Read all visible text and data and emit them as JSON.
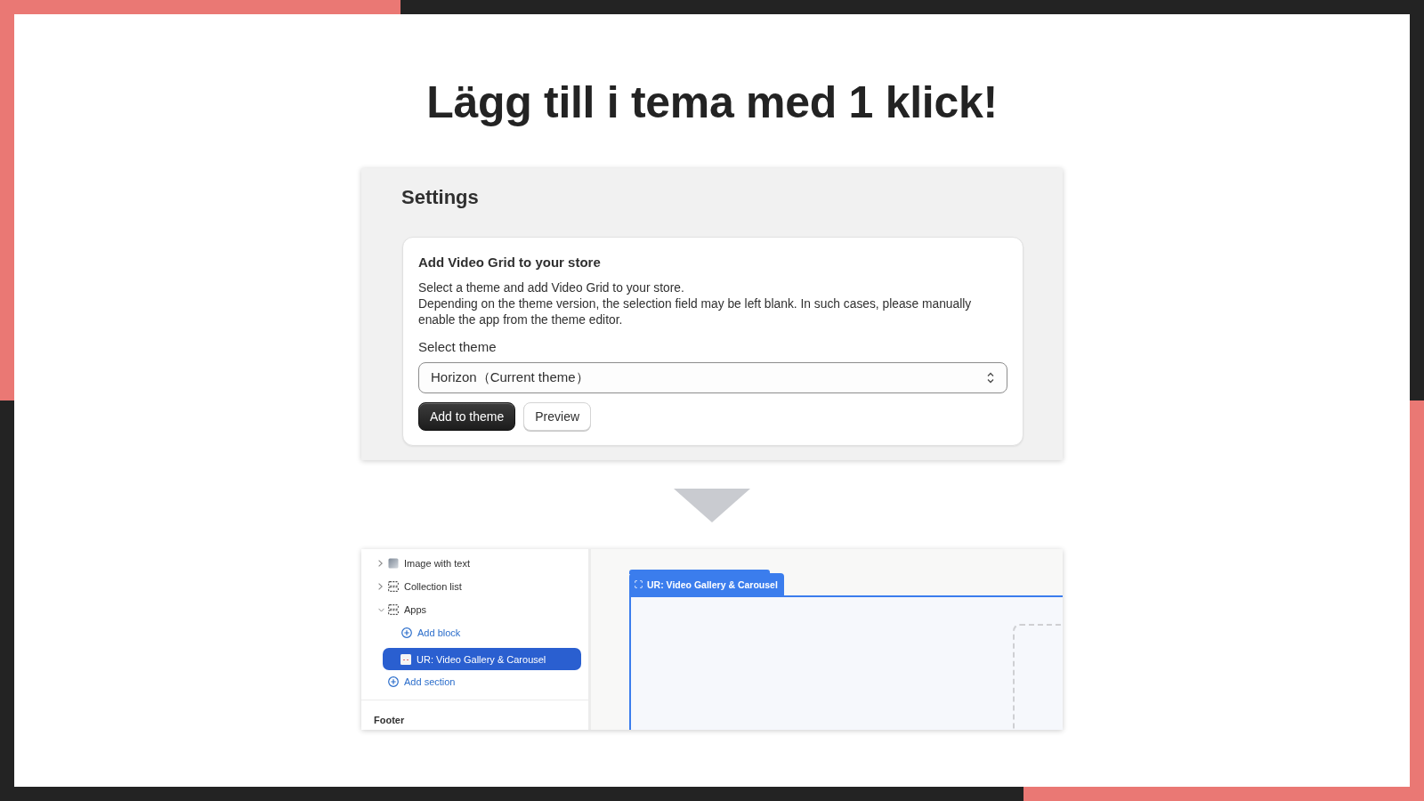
{
  "headline": "Lägg till i tema med 1 klick!",
  "settings": {
    "title": "Settings",
    "card": {
      "title": "Add Video Grid to your store",
      "description": [
        "Select a theme and add Video Grid to your store.",
        "Depending on the theme version, the selection field may be left blank. In such cases, please manually enable the app from the theme editor."
      ],
      "select": {
        "label": "Select theme",
        "value": "Horizon（Current theme）"
      },
      "buttons": [
        {
          "label": "Add to theme",
          "kind": "primary"
        },
        {
          "label": "Preview",
          "kind": "secondary"
        }
      ]
    }
  },
  "editor": {
    "sidebar": {
      "items": [
        {
          "label": "Image with text",
          "kind": "image",
          "expanded": false,
          "selected": false
        },
        {
          "label": "Collection list",
          "kind": "section",
          "expanded": false,
          "selected": false
        },
        {
          "label": "Apps",
          "kind": "section",
          "expanded": true,
          "selected": false,
          "children": [
            {
              "label": "Add block",
              "kind": "add",
              "selected": false
            },
            {
              "label": "UR: Video Gallery & Carousel",
              "kind": "block",
              "selected": true
            }
          ]
        },
        {
          "label": "Add section",
          "kind": "add",
          "selected": false
        }
      ],
      "footer": "Footer"
    },
    "preview": {
      "block_tab": "UR: Video Gallery & Carousel"
    }
  }
}
